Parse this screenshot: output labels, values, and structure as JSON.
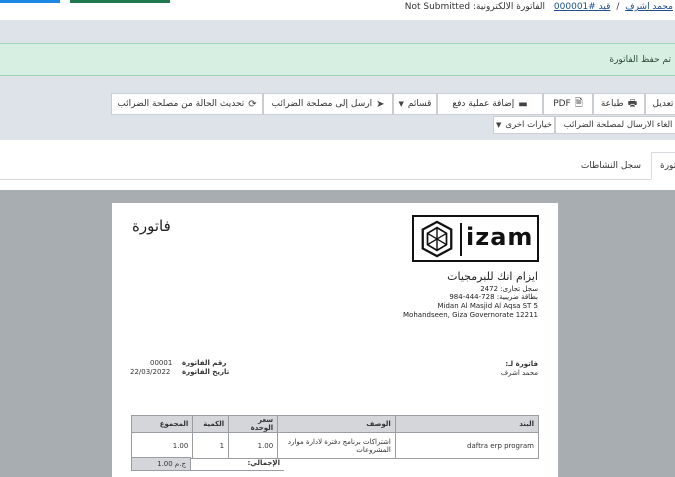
{
  "breadcrumb": {
    "user": "محمد اشرف",
    "entry": "قيد #000001",
    "doc_type": "الفاتورة الالكترونية:",
    "status": "Not Submitted"
  },
  "alert": {
    "message": "تم حفظ الفاتورة"
  },
  "toolbar": {
    "edit": "تعديل",
    "print": "طباعة",
    "pdf": "PDF",
    "add_payment": "إضافة عملية دفع",
    "templates": "قسائم",
    "send_tax": "ارسل إلى مصلحة الضرائب",
    "refresh_tax": "تحديث الحالة من مصلحة الضرائب",
    "cancel_send": "الغاء الارسال لمصلحة الضرائب",
    "more_options": "خيارات اخرى"
  },
  "tabs": {
    "invoice": "فاتورة",
    "activity_log": "سجل النشاطات"
  },
  "invoice": {
    "title": "فاتورة",
    "logo_text": "izam",
    "company": {
      "name": "ايزام انك للبرمجيات",
      "commercial_reg": "سجل تجارى: 2472",
      "tax_card": "بطاقة ضريبية: 728-444-984",
      "address_1": "Midan Al Masjid Al Aqsa ST 5",
      "address_2": "Mohandseen, Giza Governorate 12211"
    },
    "meta": {
      "number_label": "رقم الفاتورة",
      "number": "00001",
      "date_label": "تاريخ الفاتورة",
      "date": "22/03/2022"
    },
    "bill_to_label": "فاتورة لـ:",
    "bill_to_name": "محمد اشرف",
    "columns": {
      "item": "البند",
      "description": "الوصف",
      "unit_price": "سعر الوحدة",
      "quantity": "الكمية",
      "total": "المجموع"
    },
    "lines": [
      {
        "item": "daftra erp program",
        "description": "اشتراكات برنامج دفترة لادارة موارد المشروعات",
        "unit_price": "1.00",
        "quantity": "1",
        "total": "1.00"
      }
    ],
    "total_label": "الإجمالي:",
    "total_value": "1.00 ج.م"
  },
  "colors": {
    "band_bg": "#dde3e8",
    "alert_bg": "#d7efe3",
    "preview_bg": "#a8adb2",
    "link": "#1f4e8c",
    "accent_blue": "#1e88e5",
    "accent_green": "#1e7a4c"
  }
}
